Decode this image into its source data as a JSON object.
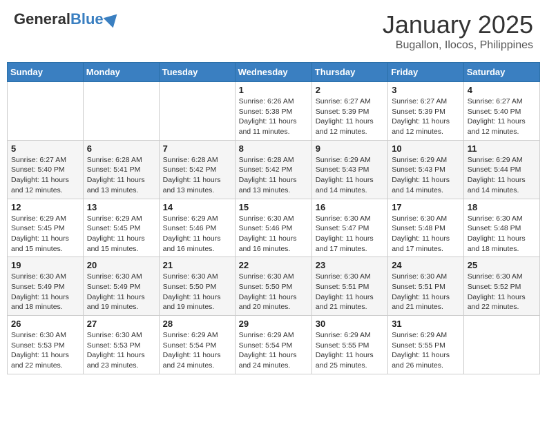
{
  "header": {
    "logo_general": "General",
    "logo_blue": "Blue",
    "month_year": "January 2025",
    "location": "Bugallon, Ilocos, Philippines"
  },
  "weekdays": [
    "Sunday",
    "Monday",
    "Tuesday",
    "Wednesday",
    "Thursday",
    "Friday",
    "Saturday"
  ],
  "weeks": [
    [
      {
        "day": "",
        "sunrise": "",
        "sunset": "",
        "daylight": ""
      },
      {
        "day": "",
        "sunrise": "",
        "sunset": "",
        "daylight": ""
      },
      {
        "day": "",
        "sunrise": "",
        "sunset": "",
        "daylight": ""
      },
      {
        "day": "1",
        "sunrise": "Sunrise: 6:26 AM",
        "sunset": "Sunset: 5:38 PM",
        "daylight": "Daylight: 11 hours and 11 minutes."
      },
      {
        "day": "2",
        "sunrise": "Sunrise: 6:27 AM",
        "sunset": "Sunset: 5:39 PM",
        "daylight": "Daylight: 11 hours and 12 minutes."
      },
      {
        "day": "3",
        "sunrise": "Sunrise: 6:27 AM",
        "sunset": "Sunset: 5:39 PM",
        "daylight": "Daylight: 11 hours and 12 minutes."
      },
      {
        "day": "4",
        "sunrise": "Sunrise: 6:27 AM",
        "sunset": "Sunset: 5:40 PM",
        "daylight": "Daylight: 11 hours and 12 minutes."
      }
    ],
    [
      {
        "day": "5",
        "sunrise": "Sunrise: 6:27 AM",
        "sunset": "Sunset: 5:40 PM",
        "daylight": "Daylight: 11 hours and 12 minutes."
      },
      {
        "day": "6",
        "sunrise": "Sunrise: 6:28 AM",
        "sunset": "Sunset: 5:41 PM",
        "daylight": "Daylight: 11 hours and 13 minutes."
      },
      {
        "day": "7",
        "sunrise": "Sunrise: 6:28 AM",
        "sunset": "Sunset: 5:42 PM",
        "daylight": "Daylight: 11 hours and 13 minutes."
      },
      {
        "day": "8",
        "sunrise": "Sunrise: 6:28 AM",
        "sunset": "Sunset: 5:42 PM",
        "daylight": "Daylight: 11 hours and 13 minutes."
      },
      {
        "day": "9",
        "sunrise": "Sunrise: 6:29 AM",
        "sunset": "Sunset: 5:43 PM",
        "daylight": "Daylight: 11 hours and 14 minutes."
      },
      {
        "day": "10",
        "sunrise": "Sunrise: 6:29 AM",
        "sunset": "Sunset: 5:43 PM",
        "daylight": "Daylight: 11 hours and 14 minutes."
      },
      {
        "day": "11",
        "sunrise": "Sunrise: 6:29 AM",
        "sunset": "Sunset: 5:44 PM",
        "daylight": "Daylight: 11 hours and 14 minutes."
      }
    ],
    [
      {
        "day": "12",
        "sunrise": "Sunrise: 6:29 AM",
        "sunset": "Sunset: 5:45 PM",
        "daylight": "Daylight: 11 hours and 15 minutes."
      },
      {
        "day": "13",
        "sunrise": "Sunrise: 6:29 AM",
        "sunset": "Sunset: 5:45 PM",
        "daylight": "Daylight: 11 hours and 15 minutes."
      },
      {
        "day": "14",
        "sunrise": "Sunrise: 6:29 AM",
        "sunset": "Sunset: 5:46 PM",
        "daylight": "Daylight: 11 hours and 16 minutes."
      },
      {
        "day": "15",
        "sunrise": "Sunrise: 6:30 AM",
        "sunset": "Sunset: 5:46 PM",
        "daylight": "Daylight: 11 hours and 16 minutes."
      },
      {
        "day": "16",
        "sunrise": "Sunrise: 6:30 AM",
        "sunset": "Sunset: 5:47 PM",
        "daylight": "Daylight: 11 hours and 17 minutes."
      },
      {
        "day": "17",
        "sunrise": "Sunrise: 6:30 AM",
        "sunset": "Sunset: 5:48 PM",
        "daylight": "Daylight: 11 hours and 17 minutes."
      },
      {
        "day": "18",
        "sunrise": "Sunrise: 6:30 AM",
        "sunset": "Sunset: 5:48 PM",
        "daylight": "Daylight: 11 hours and 18 minutes."
      }
    ],
    [
      {
        "day": "19",
        "sunrise": "Sunrise: 6:30 AM",
        "sunset": "Sunset: 5:49 PM",
        "daylight": "Daylight: 11 hours and 18 minutes."
      },
      {
        "day": "20",
        "sunrise": "Sunrise: 6:30 AM",
        "sunset": "Sunset: 5:49 PM",
        "daylight": "Daylight: 11 hours and 19 minutes."
      },
      {
        "day": "21",
        "sunrise": "Sunrise: 6:30 AM",
        "sunset": "Sunset: 5:50 PM",
        "daylight": "Daylight: 11 hours and 19 minutes."
      },
      {
        "day": "22",
        "sunrise": "Sunrise: 6:30 AM",
        "sunset": "Sunset: 5:50 PM",
        "daylight": "Daylight: 11 hours and 20 minutes."
      },
      {
        "day": "23",
        "sunrise": "Sunrise: 6:30 AM",
        "sunset": "Sunset: 5:51 PM",
        "daylight": "Daylight: 11 hours and 21 minutes."
      },
      {
        "day": "24",
        "sunrise": "Sunrise: 6:30 AM",
        "sunset": "Sunset: 5:51 PM",
        "daylight": "Daylight: 11 hours and 21 minutes."
      },
      {
        "day": "25",
        "sunrise": "Sunrise: 6:30 AM",
        "sunset": "Sunset: 5:52 PM",
        "daylight": "Daylight: 11 hours and 22 minutes."
      }
    ],
    [
      {
        "day": "26",
        "sunrise": "Sunrise: 6:30 AM",
        "sunset": "Sunset: 5:53 PM",
        "daylight": "Daylight: 11 hours and 22 minutes."
      },
      {
        "day": "27",
        "sunrise": "Sunrise: 6:30 AM",
        "sunset": "Sunset: 5:53 PM",
        "daylight": "Daylight: 11 hours and 23 minutes."
      },
      {
        "day": "28",
        "sunrise": "Sunrise: 6:29 AM",
        "sunset": "Sunset: 5:54 PM",
        "daylight": "Daylight: 11 hours and 24 minutes."
      },
      {
        "day": "29",
        "sunrise": "Sunrise: 6:29 AM",
        "sunset": "Sunset: 5:54 PM",
        "daylight": "Daylight: 11 hours and 24 minutes."
      },
      {
        "day": "30",
        "sunrise": "Sunrise: 6:29 AM",
        "sunset": "Sunset: 5:55 PM",
        "daylight": "Daylight: 11 hours and 25 minutes."
      },
      {
        "day": "31",
        "sunrise": "Sunrise: 6:29 AM",
        "sunset": "Sunset: 5:55 PM",
        "daylight": "Daylight: 11 hours and 26 minutes."
      },
      {
        "day": "",
        "sunrise": "",
        "sunset": "",
        "daylight": ""
      }
    ]
  ]
}
